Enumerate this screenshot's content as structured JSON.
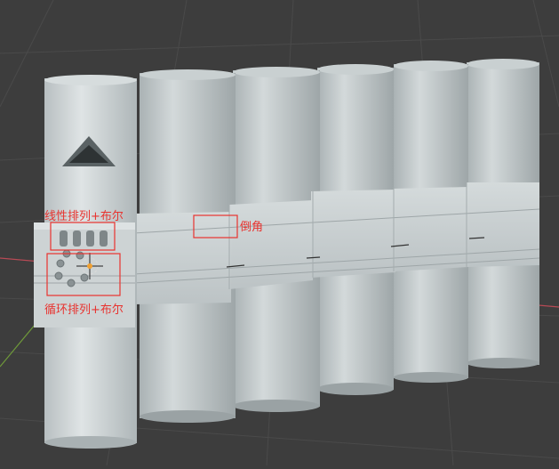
{
  "viewport": {
    "background": "#3d3d3d",
    "grid_color": "#4a4a4a",
    "x_axis_color": "#b84a55",
    "y_axis_color": "#6f9a3a"
  },
  "model": {
    "body_color": "#c8cfd0",
    "shade_color": "#a9b1b3",
    "dark_color": "#8c9496"
  },
  "annotations": [
    {
      "id": "linear-array",
      "label": "线性排列+布尔",
      "color": "#e8332f"
    },
    {
      "id": "bevel",
      "label": "倒角",
      "color": "#e8332f"
    },
    {
      "id": "circular-array",
      "label": "循环排列+布尔",
      "color": "#e8332f"
    }
  ],
  "gizmo": {
    "origin_color": "#f0a030"
  }
}
